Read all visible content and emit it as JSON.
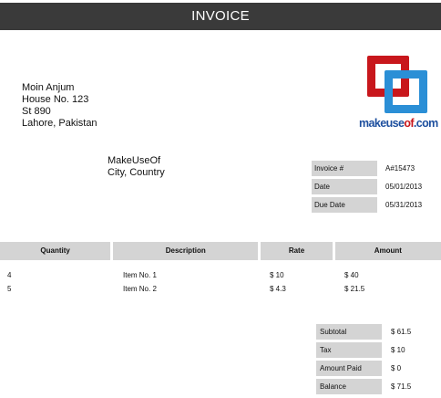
{
  "title": "INVOICE",
  "from": {
    "name": "Moin Anjum",
    "address1": "House No. 123",
    "address2": "St 890",
    "city": "Lahore, Pakistan"
  },
  "to": {
    "name": "MakeUseOf",
    "city": "City, Country"
  },
  "logo": {
    "word_main": "makeuse",
    "word_of": "of",
    "word_tld": ".com",
    "colors": {
      "red": "#c8171c",
      "blue": "#2b8fd6",
      "text": "#1d4f9e"
    }
  },
  "meta": [
    {
      "label": "Invoice #",
      "value": "A#15473"
    },
    {
      "label": "Date",
      "value": "05/01/2013"
    },
    {
      "label": "Due Date",
      "value": "05/31/2013"
    }
  ],
  "table": {
    "headers": {
      "quantity": "Quantity",
      "description": "Description",
      "rate": "Rate",
      "amount": "Amount"
    },
    "rows": [
      {
        "quantity": "4",
        "description": "Item No. 1",
        "rate": "$ 10",
        "amount": "$ 40"
      },
      {
        "quantity": "5",
        "description": "Item No. 2",
        "rate": "$ 4.3",
        "amount": "$ 21.5"
      }
    ]
  },
  "totals": [
    {
      "label": "Subtotal",
      "value": "$ 61.5"
    },
    {
      "label": "Tax",
      "value": "$ 10"
    },
    {
      "label": "Amount Paid",
      "value": "$ 0"
    },
    {
      "label": "Balance",
      "value": "$ 71.5"
    }
  ],
  "colors": {
    "header_bg": "#3a3a3a",
    "cell_bg": "#d4d4d4"
  }
}
